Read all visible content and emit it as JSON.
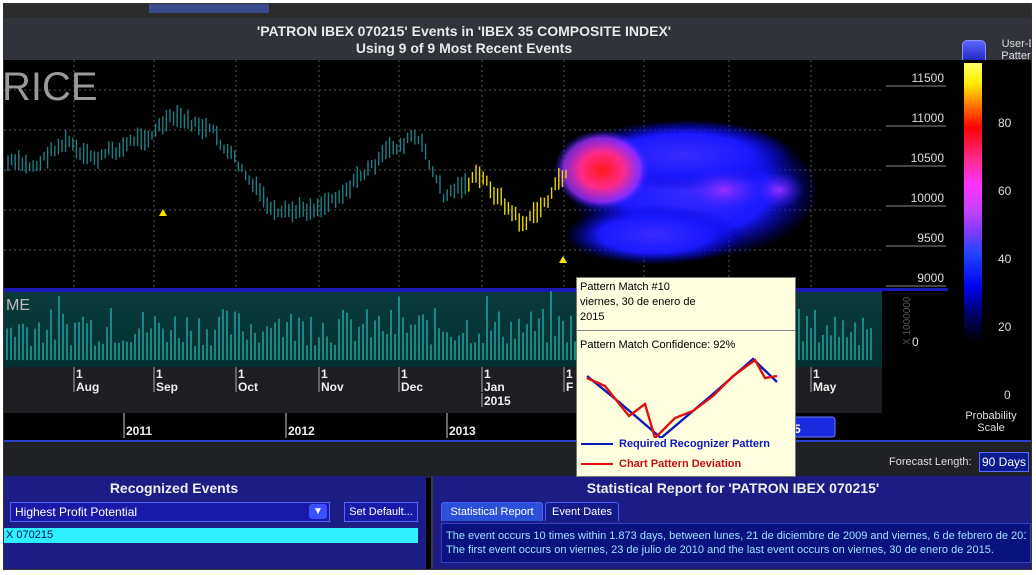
{
  "header": {
    "title_line1": "'PATRON IBEX 070215' Events in 'IBEX 35 COMPOSITE INDEX'",
    "title_line2": "Using 9 of 9 Most Recent Events",
    "user_label": "User-D Pattern"
  },
  "chart": {
    "price_watermark": "RICE",
    "volume_watermark": "ME",
    "price_ticks": [
      "11500",
      "11000",
      "10500",
      "10000",
      "9500",
      "9000"
    ],
    "volume_tick": "0",
    "volume_side_label": "X 1000000",
    "month_labels": [
      {
        "num": "1",
        "name": "Aug"
      },
      {
        "num": "1",
        "name": "Sep"
      },
      {
        "num": "1",
        "name": "Oct"
      },
      {
        "num": "1",
        "name": "Nov"
      },
      {
        "num": "1",
        "name": "Dec"
      },
      {
        "num": "1",
        "name": "Jan"
      },
      {
        "num": "1",
        "name": "F"
      },
      {
        "num": "1",
        "name": "May"
      }
    ],
    "year_label": "2015",
    "years_strip": [
      "2011",
      "2012",
      "2013",
      "5"
    ]
  },
  "scale": {
    "labels": [
      "80",
      "60",
      "40",
      "20",
      "0"
    ],
    "caption": "Probability Scale",
    "colors": {
      "high": "#ffff33",
      "mid": "#ff33ff",
      "low": "#0000ee",
      "zero": "#000000"
    }
  },
  "forecast": {
    "label": "Forecast Length:",
    "value": "90 Days"
  },
  "recognized": {
    "title": "Recognized Events",
    "select_value": "Highest Profit Potential",
    "set_default": "Set Default...",
    "selected_item": "X 070215"
  },
  "stats": {
    "title": "Statistical Report for 'PATRON IBEX 070215'",
    "tabs": [
      "Statistical Report",
      "Event Dates"
    ],
    "line1": "The event occurs 10 times within 1.873 days, between lunes, 21 de diciembre de 2009 and viernes, 6 de febrero de 201",
    "line2": "The first event occurs on viernes, 23 de julio de 2010 and the last event occurs on viernes, 30 de enero de 2015."
  },
  "popup": {
    "line1": "Pattern Match #10",
    "line2": "viernes, 30 de enero de",
    "line3": "2015",
    "confidence": "Pattern Match Confidence: 92%",
    "legend_required": "Required Recognizer Pattern",
    "legend_deviation": "Chart Pattern Deviation",
    "colors": {
      "required": "#0a1ab8",
      "deviation": "#e01010"
    }
  }
}
